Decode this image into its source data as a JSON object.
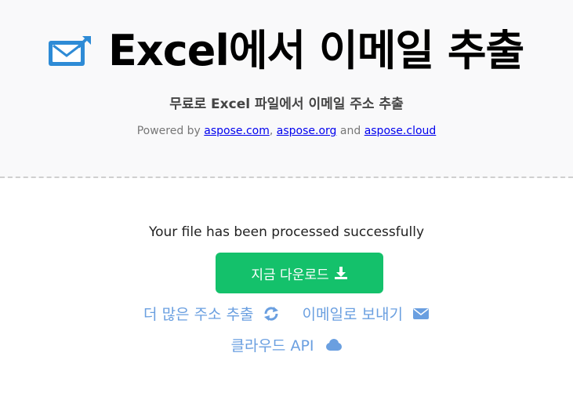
{
  "header": {
    "title": "Excel에서 이메일 추출",
    "subtitle": "무료로 Excel 파일에서 이메일 주소 추출",
    "powered_prefix": "Powered by ",
    "links": [
      "aspose.com",
      "aspose.org",
      "aspose.cloud"
    ],
    "sep_comma": ", ",
    "sep_and": " and "
  },
  "main": {
    "status": "Your file has been processed successfully",
    "download_label": "지금 다운로드",
    "more_label": "더 많은 주소 추출",
    "email_label": "이메일로 보내기",
    "cloud_label": "클라우드 API"
  },
  "colors": {
    "accent_green": "#14c16b",
    "link_blue": "#6a9fe0",
    "icon_blue": "#2e8bd6"
  },
  "icons": [
    "email-extract-app-icon",
    "download-icon",
    "refresh-icon",
    "envelope-icon",
    "cloud-icon"
  ]
}
